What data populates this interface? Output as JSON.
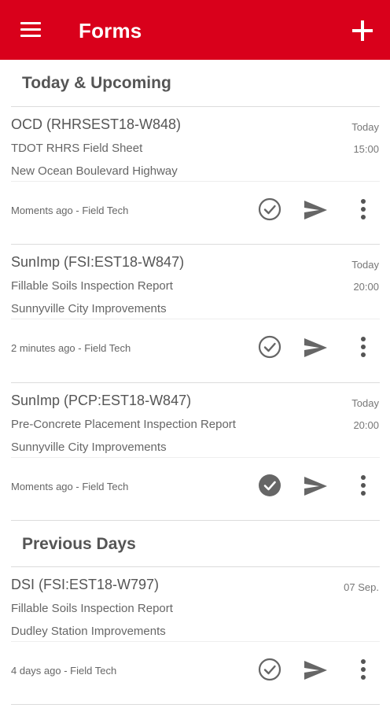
{
  "appbar": {
    "title": "Forms",
    "menu_icon": "hamburger-menu-icon",
    "add_icon": "plus-icon",
    "color": "#d9001b"
  },
  "sections": [
    {
      "title": "Today & Upcoming",
      "cards": [
        {
          "id": "OCD (RHRSEST18-W848)",
          "form": "TDOT RHRS Field Sheet",
          "project": "New Ocean Boulevard Highway",
          "date": "Today",
          "time": "15:00",
          "meta": "Moments ago - Field Tech",
          "completed": false
        },
        {
          "id": "SunImp (FSI:EST18-W847)",
          "form": "Fillable Soils Inspection Report",
          "project": "Sunnyville City Improvements",
          "date": "Today",
          "time": "20:00",
          "meta": "2 minutes ago - Field Tech",
          "completed": false
        },
        {
          "id": "SunImp (PCP:EST18-W847)",
          "form": "Pre-Concrete Placement Inspection Report",
          "project": "Sunnyville City Improvements",
          "date": "Today",
          "time": "20:00",
          "meta": "Moments ago - Field Tech",
          "completed": true
        }
      ]
    },
    {
      "title": "Previous Days",
      "cards": [
        {
          "id": "DSI (FSI:EST18-W797)",
          "form": "Fillable Soils Inspection Report",
          "project": "Dudley Station Improvements",
          "date": "07 Sep.",
          "time": "",
          "meta": "4 days ago - Field Tech",
          "completed": false
        }
      ]
    }
  ],
  "icons": {
    "check": "check-circle-icon",
    "send": "send-icon",
    "more": "more-vertical-icon"
  },
  "colors": {
    "icon": "#666666",
    "divider": "#dcdcdc"
  }
}
